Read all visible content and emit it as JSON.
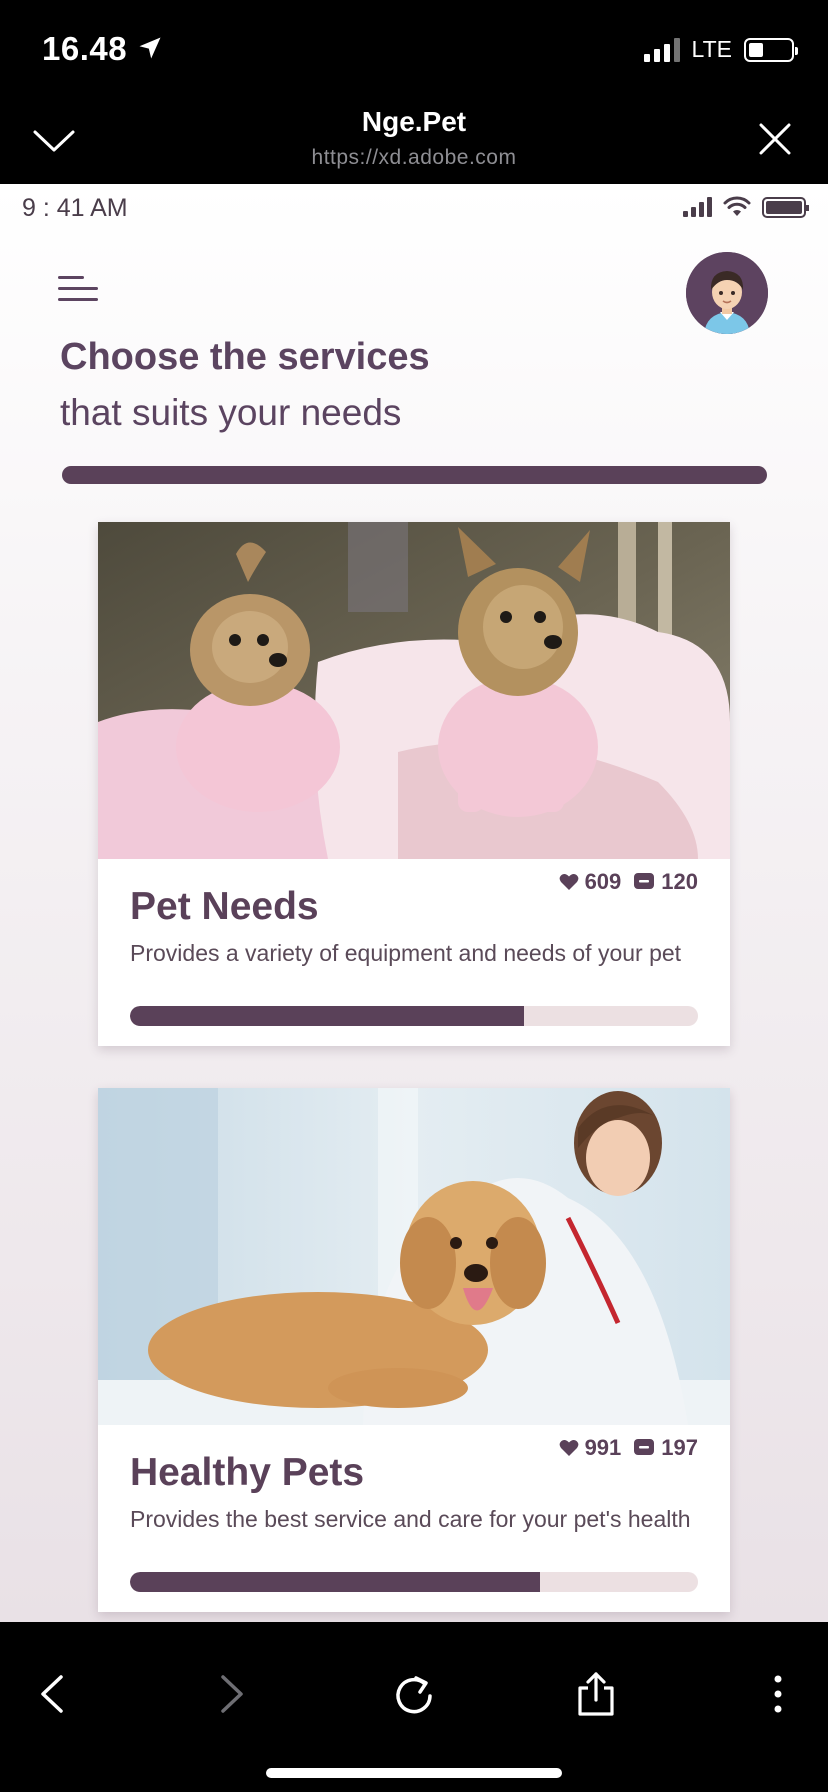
{
  "device_status": {
    "time": "16.48",
    "network": "LTE"
  },
  "browser": {
    "title": "Nge.Pet",
    "url": "https://xd.adobe.com"
  },
  "app_status": {
    "time": "9 : 41 AM"
  },
  "header": {
    "title": "Choose the services",
    "subtitle": "that suits your needs"
  },
  "cards": [
    {
      "title": "Pet Needs",
      "description": "Provides a variety of equipment and needs of your pet",
      "likes": "609",
      "comments": "120",
      "progress": 0.694
    },
    {
      "title": "Healthy Pets",
      "description": "Provides the best service and care for your pet's health",
      "likes": "991",
      "comments": "197",
      "progress": 0.722
    }
  ],
  "icons": {
    "location": "location-arrow-icon",
    "menu": "hamburger-menu-icon",
    "like": "heart-icon",
    "comment": "comment-icon"
  },
  "colors": {
    "accent": "#5a4159",
    "track": "#ece0e2"
  }
}
